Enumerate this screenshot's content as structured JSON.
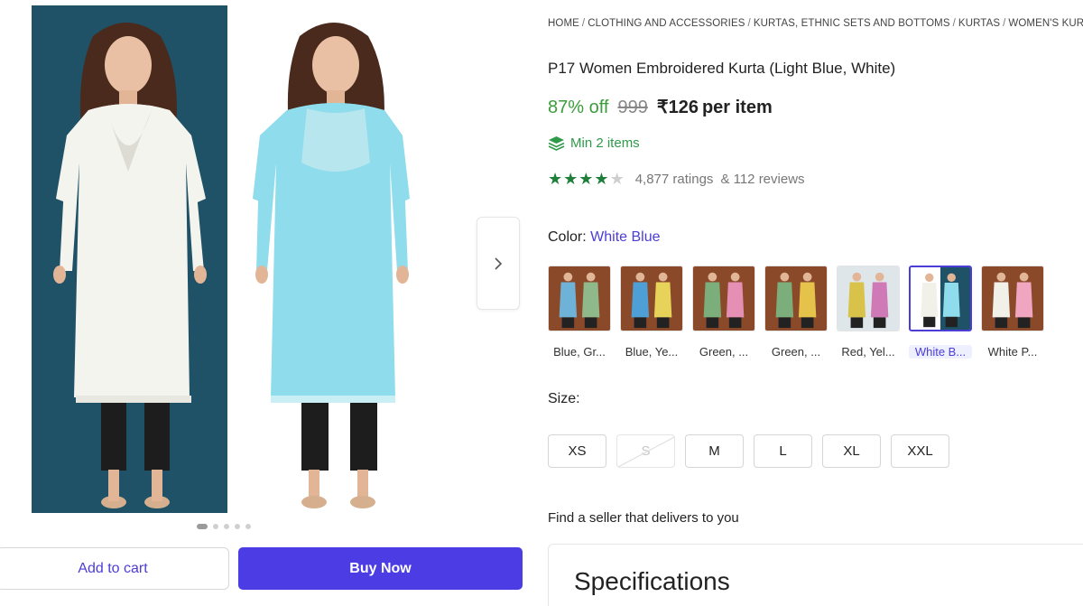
{
  "breadcrumb": [
    {
      "label": "HOME"
    },
    {
      "label": "CLOTHING AND ACCESSORIES"
    },
    {
      "label": "KURTAS, ETHNIC SETS AND BOTTOMS"
    },
    {
      "label": "KURTAS"
    },
    {
      "label": "WOMEN'S KURTAS"
    }
  ],
  "breadcrumb_separator": "/",
  "product": {
    "title": "P17 Women Embroidered Kurta (Light Blue, White)",
    "discount": "87% off",
    "mrp": "999",
    "price": "₹126",
    "price_suffix": "per item",
    "min_items": "Min 2 items",
    "rating_stars": 4,
    "rating_max": 5,
    "ratings_text": "4,877 ratings",
    "reviews_text": "& 112 reviews"
  },
  "gallery": {
    "dot_count": 5,
    "active_dot": 0,
    "next_icon": "chevron-right-icon"
  },
  "color": {
    "label": "Color:",
    "selected": "White Blue",
    "options": [
      {
        "label": "Blue, Gr..."
      },
      {
        "label": "Blue, Ye..."
      },
      {
        "label": "Green, ..."
      },
      {
        "label": "Green, ..."
      },
      {
        "label": "Red, Yel..."
      },
      {
        "label": "White B..."
      },
      {
        "label": "White P..."
      }
    ],
    "selected_index": 5
  },
  "size": {
    "label": "Size:",
    "options": [
      {
        "label": "XS",
        "available": true
      },
      {
        "label": "S",
        "available": false
      },
      {
        "label": "M",
        "available": true
      },
      {
        "label": "L",
        "available": true
      },
      {
        "label": "XL",
        "available": true
      },
      {
        "label": "XXL",
        "available": true
      }
    ]
  },
  "seller_text": "Find a seller that delivers to you",
  "specifications_title": "Specifications",
  "actions": {
    "add_to_cart": "Add to cart",
    "buy_now": "Buy Now"
  },
  "colors": {
    "accent": "#4b3de3",
    "link": "#4b3dd6",
    "discount": "#3a9d3a",
    "star": "#1e7f3a",
    "image_backdrop": "#1f5266",
    "kurta_blue": "#8fdcec",
    "kurta_white": "#f4f4ee"
  }
}
